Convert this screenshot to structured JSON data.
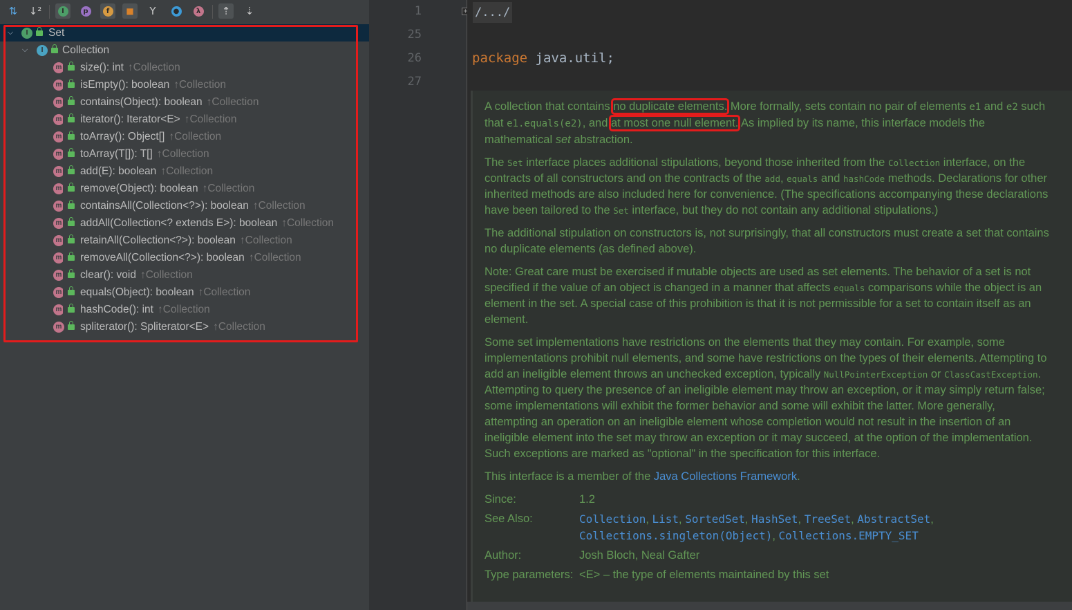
{
  "toolbar": {
    "buttons": [
      {
        "name": "sort-by-type-icon",
        "glyph": "↓⇅"
      },
      {
        "name": "sort-alphabetically-icon",
        "glyph": "↓a"
      },
      {
        "name": "show-inherited-icon",
        "glyph": "I"
      },
      {
        "name": "show-properties-icon",
        "glyph": "p"
      },
      {
        "name": "show-fields-icon",
        "glyph": "f"
      },
      {
        "name": "show-non-public-icon",
        "glyph": "🔒"
      },
      {
        "name": "show-lambdas-icon",
        "glyph": "Y"
      },
      {
        "name": "show-anonymous-icon",
        "glyph": "o"
      },
      {
        "name": "show-lambda-icon",
        "glyph": "λ"
      },
      {
        "name": "autoscroll-to-source-icon",
        "glyph": "⇑"
      },
      {
        "name": "autoscroll-from-source-icon",
        "glyph": "⇓"
      }
    ]
  },
  "tree": {
    "root": {
      "label": "Set"
    },
    "parent": {
      "label": "Collection"
    },
    "inherited_from": "Collection",
    "methods": [
      {
        "sig": "size(): int"
      },
      {
        "sig": "isEmpty(): boolean"
      },
      {
        "sig": "contains(Object): boolean"
      },
      {
        "sig": "iterator(): Iterator<E>"
      },
      {
        "sig": "toArray(): Object[]"
      },
      {
        "sig": "toArray(T[]): T[]"
      },
      {
        "sig": "add(E): boolean"
      },
      {
        "sig": "remove(Object): boolean"
      },
      {
        "sig": "containsAll(Collection<?>): boolean"
      },
      {
        "sig": "addAll(Collection<? extends E>): boolean"
      },
      {
        "sig": "retainAll(Collection<?>): boolean"
      },
      {
        "sig": "removeAll(Collection<?>): boolean"
      },
      {
        "sig": "clear(): void"
      },
      {
        "sig": "equals(Object): boolean"
      },
      {
        "sig": "hashCode(): int"
      },
      {
        "sig": "spliterator(): Spliterator<E>"
      }
    ]
  },
  "gutter": {
    "line_numbers": [
      "1",
      "25",
      "26",
      "27"
    ],
    "fold_symbol": "+"
  },
  "editor": {
    "folded_text": "/.../",
    "package_kw": "package",
    "package_name": " java.util;",
    "doc": {
      "p1": {
        "a": "A collection that contains ",
        "hl1": "no duplicate elements.",
        "b": " More formally, sets contain no pair of elements ",
        "c1": "e1",
        "c": " and ",
        "c2": "e2",
        "d": " such that ",
        "c3": "e1.equals(e2)",
        "e": ", and ",
        "hl2": "at most one null element.",
        "f": " As implied by its name, this interface models the mathematical ",
        "em": "set",
        "g": " abstraction."
      },
      "p2": {
        "a": "The ",
        "c1": "Set",
        "b": " interface places additional stipulations, beyond those inherited from the ",
        "c2": "Collection",
        "c": " interface, on the contracts of all constructors and on the contracts of the ",
        "c3": "add",
        "d": ", ",
        "c4": "equals",
        "e": " and ",
        "c5": "hashCode",
        "f": " methods. Declarations for other inherited methods are also included here for convenience. (The specifications accompanying these declarations have been tailored to the ",
        "c6": "Set",
        "g": " interface, but they do not contain any additional stipulations.)"
      },
      "p3": "The additional stipulation on constructors is, not surprisingly, that all constructors must create a set that contains no duplicate elements (as defined above).",
      "p4": {
        "a": "Note: Great care must be exercised if mutable objects are used as set elements. The behavior of a set is not specified if the value of an object is changed in a manner that affects ",
        "c1": "equals",
        "b": " comparisons while the object is an element in the set. A special case of this prohibition is that it is not permissible for a set to contain itself as an element."
      },
      "p5": {
        "a": "Some set implementations have restrictions on the elements that they may contain. For example, some implementations prohibit null elements, and some have restrictions on the types of their elements. Attempting to add an ineligible element throws an unchecked exception, typically ",
        "c1": "NullPointerException",
        "b": " or ",
        "c2": "ClassCastException",
        "c": ". Attempting to query the presence of an ineligible element may throw an exception, or it may simply return false; some implementations will exhibit the former behavior and some will exhibit the latter. More generally, attempting an operation on an ineligible element whose completion would not result in the insertion of an ineligible element into the set may throw an exception or it may succeed, at the option of the implementation. Such exceptions are marked as \"optional\" in the specification for this interface."
      },
      "p6": {
        "a": "This interface is a member of the ",
        "link": "Java Collections Framework",
        "b": "."
      },
      "since": {
        "label": "Since:",
        "value": "1.2"
      },
      "see_also": {
        "label": "See Also:",
        "links": [
          "Collection",
          "List",
          "SortedSet",
          "HashSet",
          "TreeSet",
          "AbstractSet",
          "Collections.singleton(Object)",
          "Collections.EMPTY_SET"
        ],
        "sep": ", "
      },
      "author": {
        "label": "Author:",
        "value": "Josh Bloch, Neal Gafter"
      },
      "type_params": {
        "label": "Type parameters:",
        "value": "<E> – the type of elements maintained by this set"
      }
    }
  }
}
